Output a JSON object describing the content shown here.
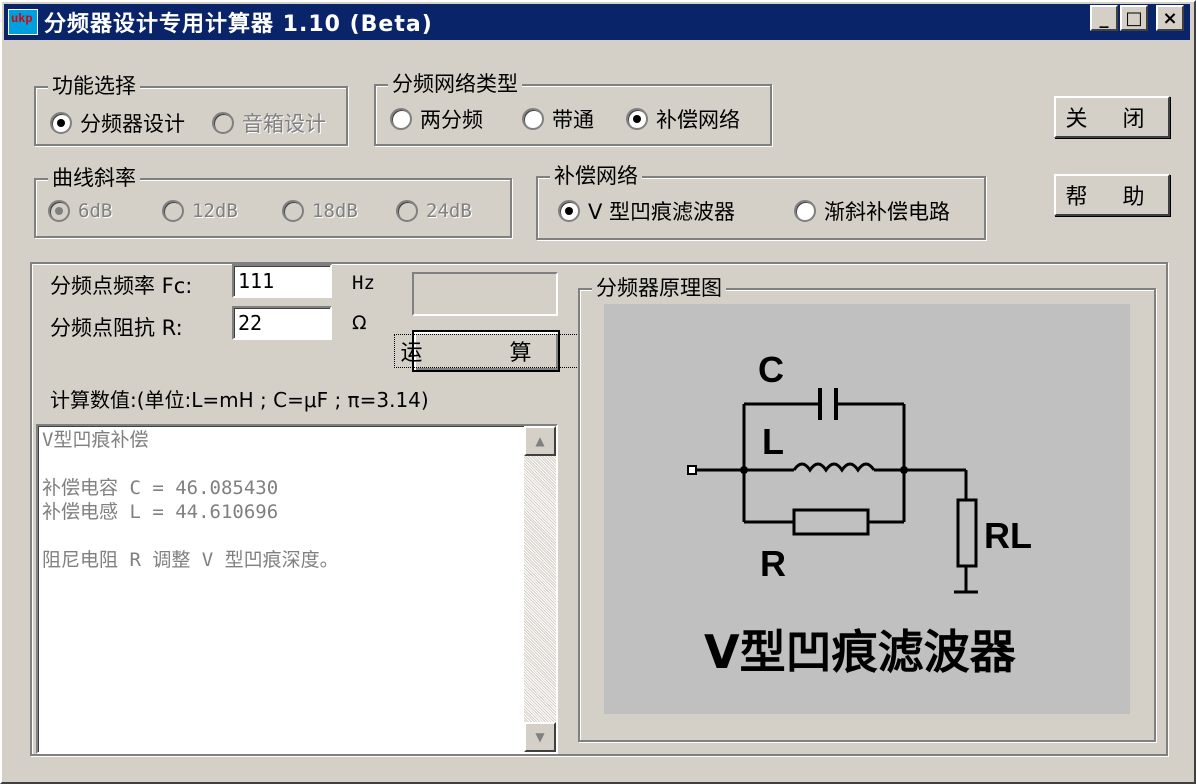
{
  "window": {
    "title": "分频器设计专用计算器 1.10 (Beta)",
    "icon_text": "ukp",
    "controls": {
      "minimize": "_",
      "maximize": "□",
      "close": "×"
    }
  },
  "function_group": {
    "label": "功能选择",
    "options": [
      {
        "label": "分频器设计",
        "checked": true,
        "enabled": true
      },
      {
        "label": "音箱设计",
        "checked": false,
        "enabled": false
      }
    ]
  },
  "network_type_group": {
    "label": "分频网络类型",
    "options": [
      {
        "label": "两分频",
        "checked": false
      },
      {
        "label": "带通",
        "checked": false
      },
      {
        "label": "补偿网络",
        "checked": true
      }
    ]
  },
  "slope_group": {
    "label": "曲线斜率",
    "options": [
      {
        "label": "6dB",
        "checked": true,
        "enabled": false
      },
      {
        "label": "12dB",
        "checked": false,
        "enabled": false
      },
      {
        "label": "18dB",
        "checked": false,
        "enabled": false
      },
      {
        "label": "24dB",
        "checked": false,
        "enabled": false
      }
    ]
  },
  "compensation_group": {
    "label": "补偿网络",
    "options": [
      {
        "label": "V 型凹痕滤波器",
        "checked": true
      },
      {
        "label": "渐斜补偿电路",
        "checked": false
      }
    ]
  },
  "buttons": {
    "close": "关 闭",
    "help": "帮 助",
    "compute": "运 算"
  },
  "inputs": {
    "fc_label": "分频点频率 Fc:",
    "fc_value": "111",
    "fc_unit": "Hz",
    "r_label": "分频点阻抗 R:",
    "r_value": "22",
    "r_unit": "Ω"
  },
  "result_label": "计算数值:(单位:L=mH ; C=μF ; π=3.14)",
  "result_text": [
    "V型凹痕补偿",
    "",
    "补偿电容 C = 46.085430",
    "补偿电感 L = 44.610696",
    "",
    "阻尼电阻 R 调整 V 型凹痕深度。"
  ],
  "diagram": {
    "label": "分频器原理图",
    "component_labels": {
      "c": "C",
      "l": "L",
      "r": "R",
      "rl": "RL"
    },
    "caption": "V型凹痕滤波器"
  }
}
